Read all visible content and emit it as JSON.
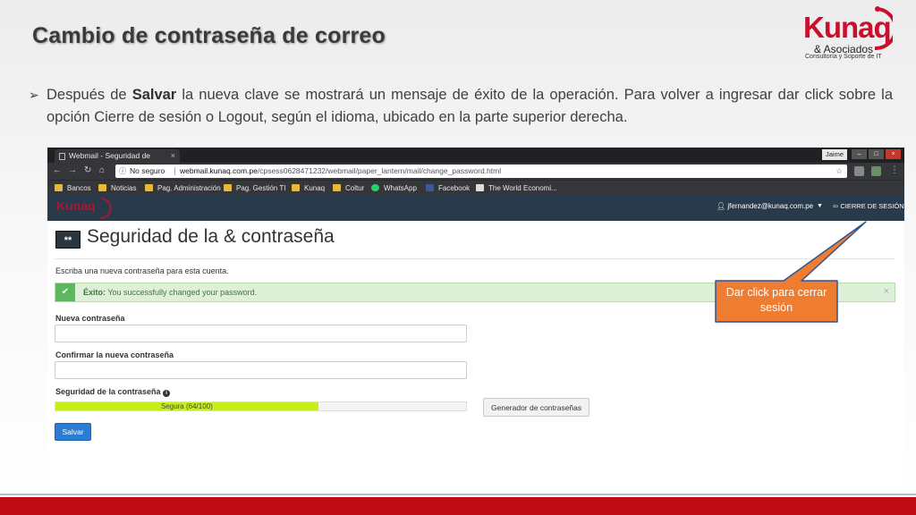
{
  "slide": {
    "title": "Cambio de contraseña de correo",
    "bullet_prefix": "Después de ",
    "bullet_bold": "Salvar",
    "bullet_suffix": " la nueva clave se mostrará un mensaje de éxito de la operación. Para volver a ingresar dar click sobre la opción Cierre de sesión o Logout, según el idioma, ubicado en la parte superior derecha.",
    "logo_word": "Kunaq",
    "logo_sub": "& Asociados",
    "logo_tag": "Consultoría y Soporte de IT",
    "callout_text": "Dar click para cerrar sesión"
  },
  "browser": {
    "tab_title": "Webmail - Seguridad de",
    "profile_name": "Jaime",
    "insecure_label": "No seguro",
    "url_host": "webmail.kunaq.com.pe",
    "url_path": "/cpsess0628471232/webmail/paper_lantern/mail/change_password.html",
    "bookmarks": [
      "Bancos",
      "Noticias",
      "Pag. Administración",
      "Pag. Gestión TI",
      "Kunaq",
      "Coltur",
      "WhatsApp",
      "Facebook",
      "The World Economi..."
    ]
  },
  "cpanel": {
    "logo_text": "Kunaq",
    "user_email": "jfernandez@kunaq.com.pe",
    "logout_label": "CIERRE DE SESIÓN",
    "page_icon_text": "**",
    "page_title": "Seguridad de la & contraseña",
    "instructions": "Escriba una nueva contraseña para esta cuenta.",
    "alert_label": "Éxito:",
    "alert_message": " You successfully changed your password.",
    "new_password_label": "Nueva contraseña",
    "confirm_password_label": "Confirmar la nueva contraseña",
    "strength_label": "Seguridad de la contraseña",
    "strength_text": "Segura (64/100)",
    "strength_value": 64,
    "generator_button": "Generador de contraseñas",
    "save_button": "Salvar"
  },
  "colors": {
    "brand_red": "#c8102e",
    "header_bg": "#293a4a",
    "success_green": "#5cb85c",
    "strength_fill": "#c6ef1a",
    "save_blue": "#2b7cd3",
    "callout_orange": "#ee7d31"
  }
}
